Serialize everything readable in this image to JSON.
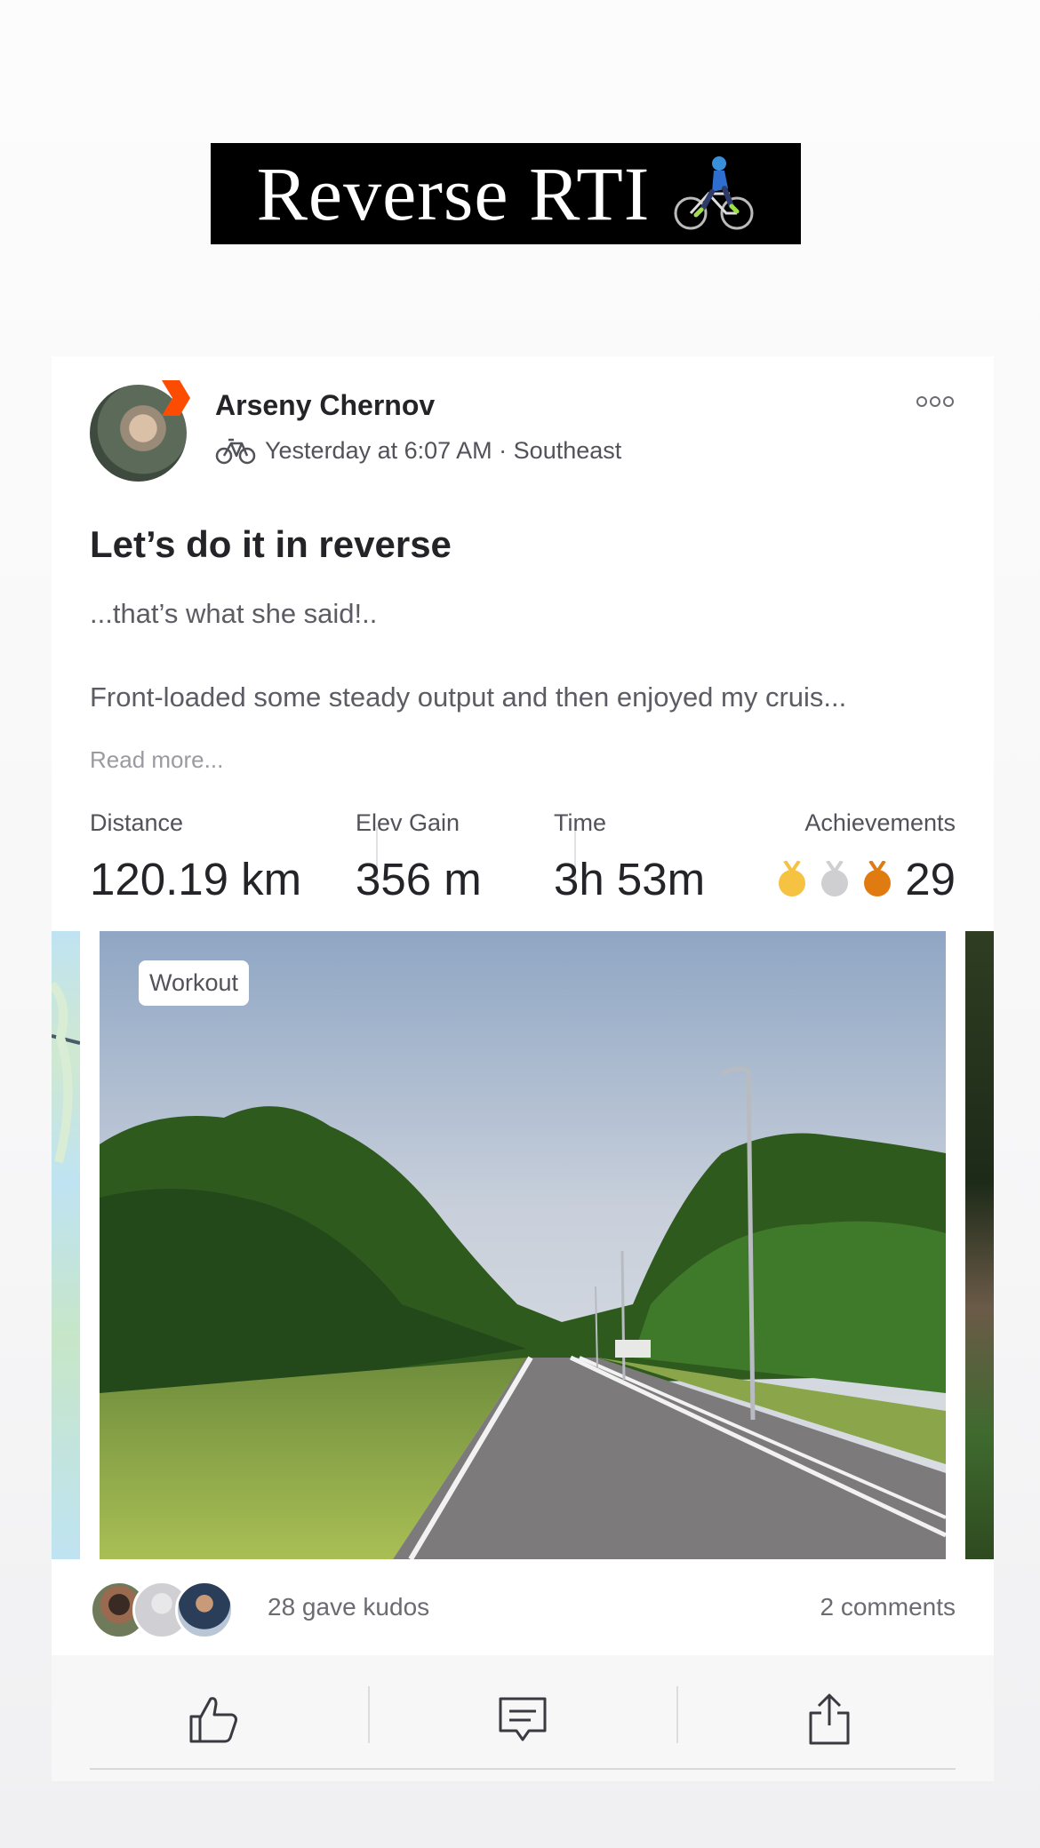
{
  "banner": {
    "text": "Reverse RTI",
    "icon": "cyclist-emoji-icon"
  },
  "post": {
    "athlete_name": "Arseny Chernov",
    "activity_icon": "bike-icon",
    "meta": "Yesterday at 6:07 AM · Southeast",
    "title": "Let’s do it in reverse",
    "description_line1": "...that’s what she said!..",
    "description_line2": "Front-loaded some steady output and then enjoyed my cruis...",
    "read_more": "Read more...",
    "stats": [
      {
        "label": "Distance",
        "value": "120.19 km"
      },
      {
        "label": "Elev Gain",
        "value": "356 m"
      },
      {
        "label": "Time",
        "value": "3h 53m"
      }
    ],
    "achievements": {
      "label": "Achievements",
      "count": "29",
      "medals": [
        "gold",
        "silver",
        "bronze"
      ]
    },
    "media": {
      "chip": "Workout"
    },
    "kudos_text": "28 gave kudos",
    "comments_text": "2 comments"
  },
  "colors": {
    "brand": "#fc4c02",
    "gold": "#f5c242",
    "silver": "#cfcfd2",
    "bronze": "#e07b12"
  },
  "actions": [
    {
      "name": "kudos-button",
      "icon": "thumbs-up-icon"
    },
    {
      "name": "comment-button",
      "icon": "comment-icon"
    },
    {
      "name": "share-button",
      "icon": "share-icon"
    }
  ]
}
